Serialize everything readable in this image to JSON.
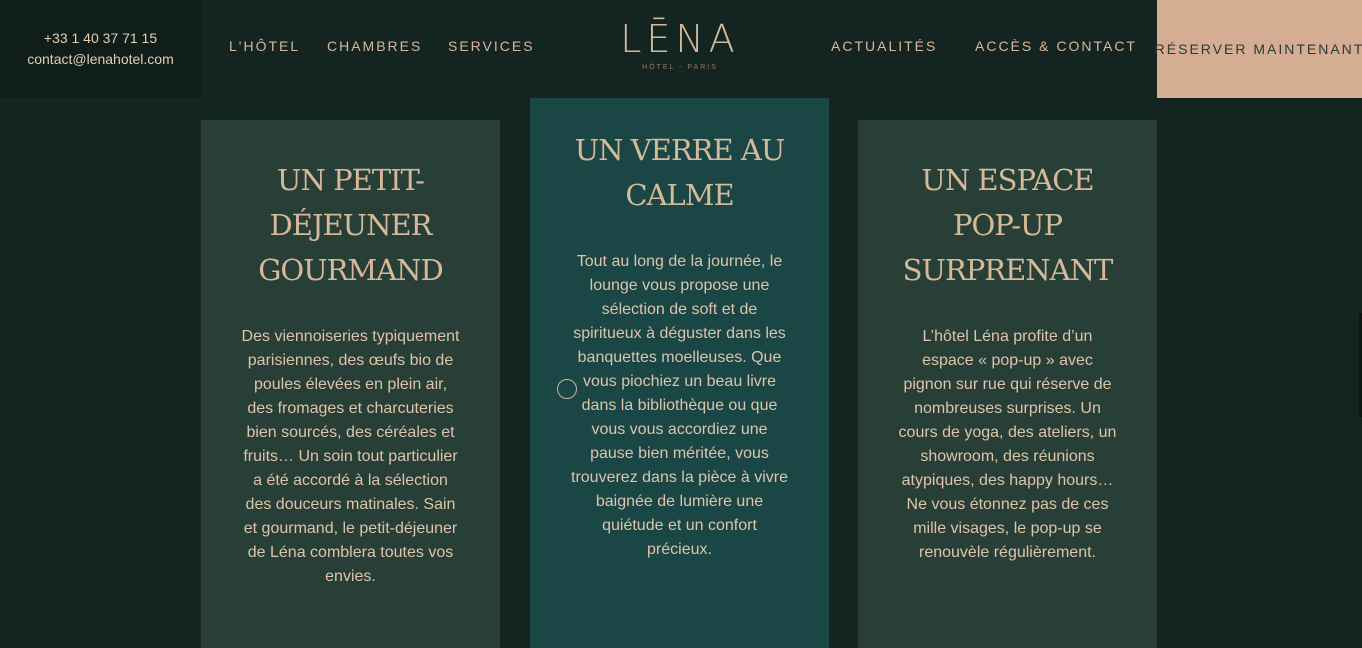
{
  "header": {
    "phone": "+33 1 40 37 71 15",
    "email": "contact@lenahotel.com",
    "nav": {
      "hotel": "L'HÔTEL",
      "chambres": "CHAMBRES",
      "services": "SERVICES",
      "actualites": "ACTUALITÉS",
      "acces": "ACCÈS & CONTACT"
    },
    "logo": {
      "name": "LĒNA",
      "tagline": "HÔTEL - PARIS"
    },
    "reserve_label": "RÉSERVER MAINTENANT"
  },
  "cards": [
    {
      "title": "UN PETIT-DÉJEUNER GOURMAND",
      "body": "Des viennoiseries typiquement parisiennes, des œufs bio de poules élevées en plein air, des fromages et charcuteries bien sourcés, des céréales et fruits… Un soin tout particulier a été accordé à la sélection des douceurs matinales. Sain et gourmand, le petit-déjeuner de Léna comblera toutes vos envies."
    },
    {
      "title": "UN VERRE AU CALME",
      "body": "Tout au long de la journée, le lounge vous propose une sélection de soft et de spiritueux à déguster dans les banquettes moelleuses. Que vous piochiez un beau livre dans la bibliothèque ou que vous vous accordiez une pause bien méritée, vous trouverez dans la pièce à vivre baignée de lumière une quiétude et un confort précieux."
    },
    {
      "title": "UN ESPACE POP-UP SURPRENANT",
      "body": "L’hôtel Léna profite d’un espace « pop-up » avec pignon sur rue qui réserve de nombreuses surprises. Un cours de yoga, des ateliers, un showroom, des réunions atypiques, des happy hours… Ne vous étonnez pas de ces mille visages, le pop-up se renouvèle régulièrement."
    }
  ],
  "colors": {
    "background": "#132421",
    "card_green": "#283f38",
    "card_teal": "#1a4645",
    "accent": "#d4ad92"
  }
}
